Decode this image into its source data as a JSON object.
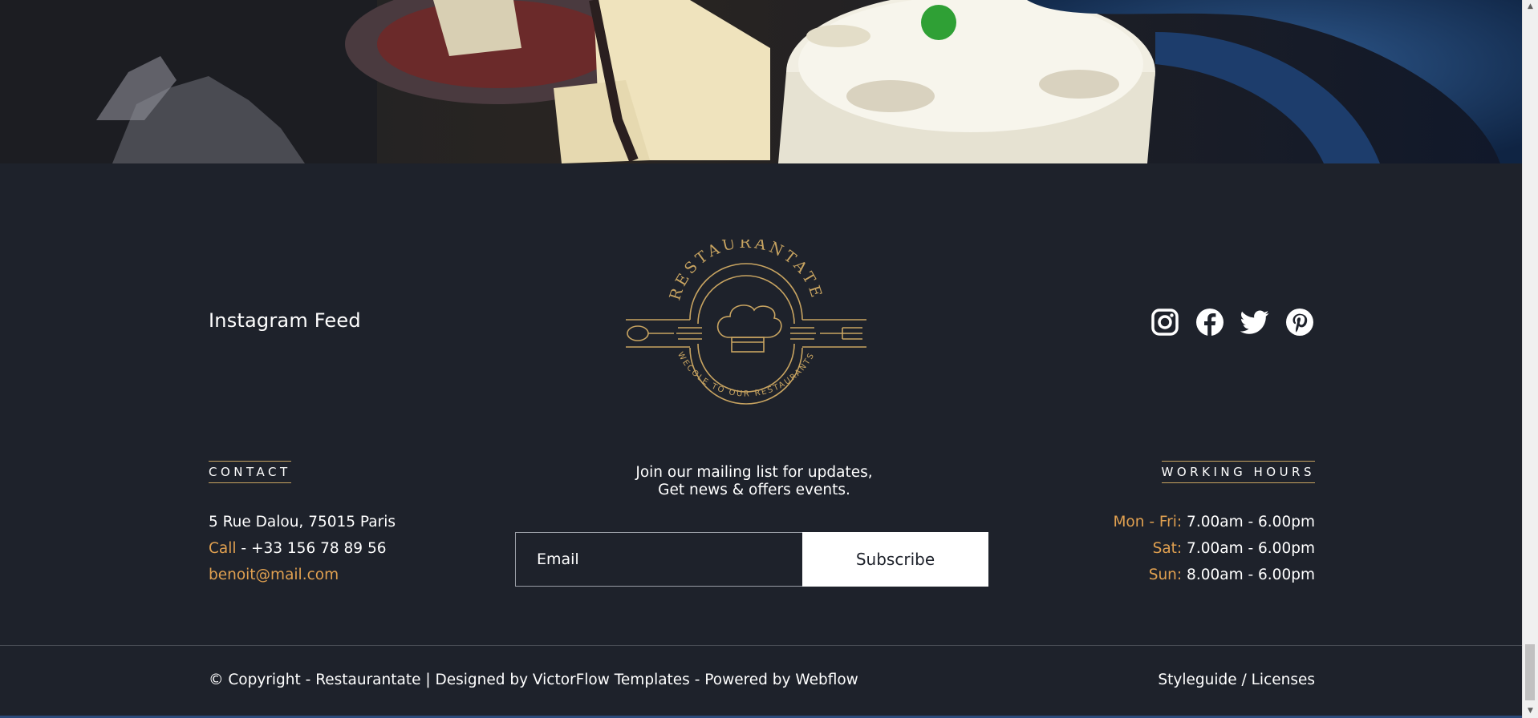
{
  "hero": {
    "image": "restaurant-dining-room-photo"
  },
  "instagram": {
    "title": "Instagram Feed"
  },
  "logo": {
    "name": "RESTAURANTATE",
    "tagline": "WECOLE TO OUR RESTAURANTS",
    "color": "#c8a461"
  },
  "socials": [
    {
      "icon": "instagram-icon"
    },
    {
      "icon": "facebook-icon"
    },
    {
      "icon": "twitter-icon"
    },
    {
      "icon": "pinterest-icon"
    }
  ],
  "contact": {
    "label": "CONTACT",
    "address": "5 Rue Dalou, 75015 Paris",
    "call_label": "Call",
    "call_sep": " - ",
    "phone": "+33 156 78 89 56",
    "email": "benoit@mail.com"
  },
  "mailing": {
    "line1": "Join our mailing list for updates,",
    "line2": "Get news & offers events.",
    "email_placeholder": "Email",
    "subscribe_label": "Subscribe"
  },
  "hours": {
    "label": "WORKING HOURS",
    "rows": [
      {
        "day": "Mon - Fri:",
        "time": "7.00am - 6.00pm"
      },
      {
        "day": "Sat:",
        "time": "7.00am - 6.00pm"
      },
      {
        "day": "Sun:",
        "time": "8.00am - 6.00pm"
      }
    ]
  },
  "bottom": {
    "copyright": "© Copyright - Restaurantate | Designed by VictorFlow Templates - Powered by Webflow",
    "legal": "Styleguide / Licenses"
  },
  "colors": {
    "background": "#1e222b",
    "accent": "#e0a050",
    "logo_gold": "#c8a461"
  }
}
